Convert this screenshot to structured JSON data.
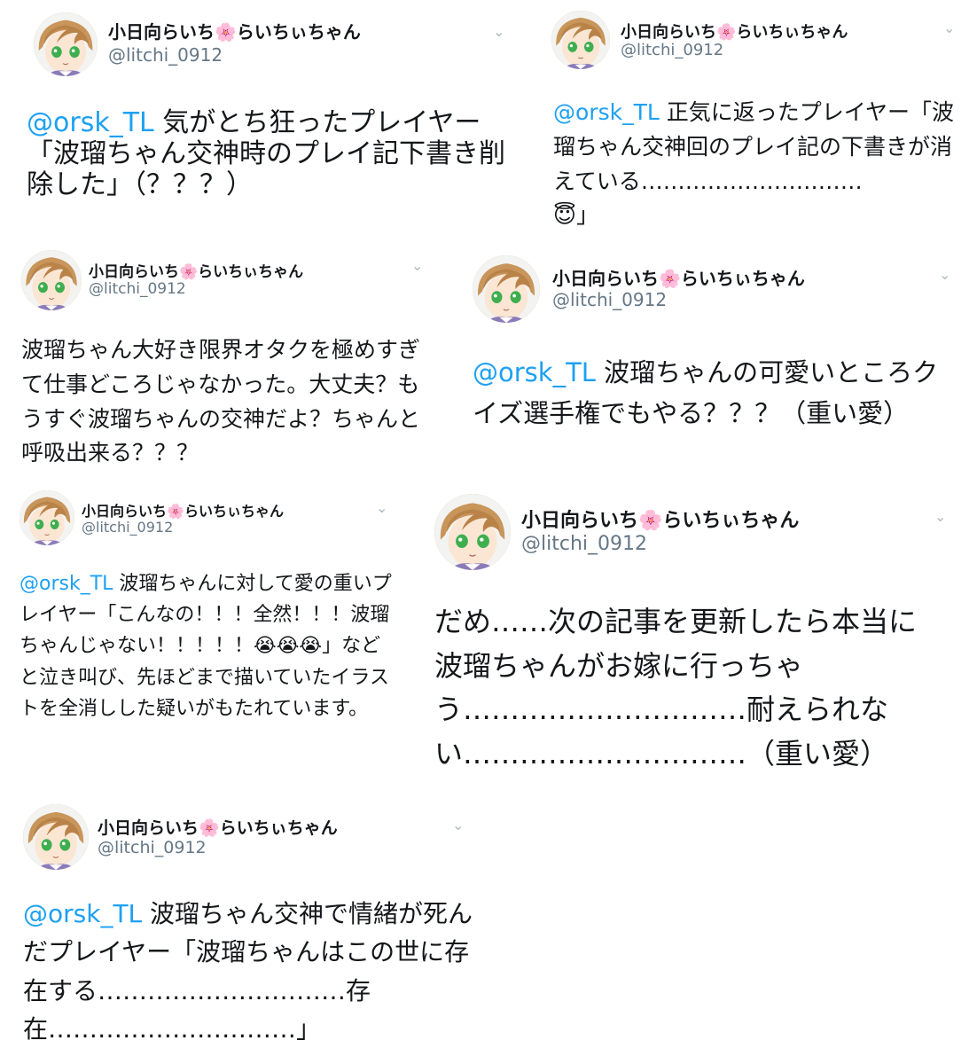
{
  "tweets": [
    {
      "display_name": "小日向らいち",
      "name_emoji": "🌸",
      "display_name_suffix": "らいちぃちゃん",
      "handle": "@litchi_0912",
      "mention": "@orsk_TL",
      "text": " 気がとち狂ったプレイヤー「波瑠ちゃん交神時のプレイ記下書き削除した」（？？？）",
      "menu_icon": "chevron-down-icon"
    },
    {
      "display_name": "小日向らいち",
      "name_emoji": "🌸",
      "display_name_suffix": "らいちぃちゃん",
      "handle": "@litchi_0912",
      "mention": "@orsk_TL",
      "text": " 正気に返ったプレイヤー「波瑠ちゃん交神回のプレイ記の下書きが消えている…………………………",
      "emoji": "😇",
      "text_end": "」",
      "menu_icon": "chevron-down-icon"
    },
    {
      "display_name": "小日向らいち",
      "name_emoji": "🌸",
      "display_name_suffix": "らいちぃちゃん",
      "handle": "@litchi_0912",
      "text": "波瑠ちゃん大好き限界オタクを極めすぎて仕事どころじゃなかった。大丈夫？もうすぐ波瑠ちゃんの交神だよ？ちゃんと呼吸出来る？？？",
      "menu_icon": "chevron-down-icon"
    },
    {
      "display_name": "小日向らいち",
      "name_emoji": "🌸",
      "display_name_suffix": "らいちぃちゃん",
      "handle": "@litchi_0912",
      "mention": "@orsk_TL",
      "text": " 波瑠ちゃんの可愛いところクイズ選手権でもやる？？？（重い愛）",
      "menu_icon": "chevron-down-icon"
    },
    {
      "display_name": "小日向らいち",
      "name_emoji": "🌸",
      "display_name_suffix": "らいちぃちゃん",
      "handle": "@litchi_0912",
      "mention": "@orsk_TL",
      "text": " 波瑠ちゃんに対して愛の重いプレイヤー「こんなの！！！全然！！！波瑠ちゃんじゃない！！！！！",
      "emoji": "😭😭😭",
      "text_end": "」などと泣き叫び、先ほどまで描いていたイラストを全消しした疑いがもたれています。",
      "menu_icon": "chevron-down-icon"
    },
    {
      "display_name": "小日向らいち",
      "name_emoji": "🌸",
      "display_name_suffix": "らいちぃちゃん",
      "handle": "@litchi_0912",
      "text": "だめ……次の記事を更新したら本当に波瑠ちゃんがお嫁に行っちゃう…………………………耐えられない…………………………（重い愛）",
      "menu_icon": "chevron-down-icon"
    },
    {
      "display_name": "小日向らいち",
      "name_emoji": "🌸",
      "display_name_suffix": "らいちぃちゃん",
      "handle": "@litchi_0912",
      "mention": "@orsk_TL",
      "text": " 波瑠ちゃん交神で情緒が死んだプレイヤー「波瑠ちゃんはこの世に存在する…………………………存在…………………………」",
      "menu_icon": "chevron-down-icon"
    }
  ],
  "colors": {
    "mention": "#1da1f2",
    "handle": "#657786",
    "text": "#14171a",
    "chevron": "#aab8c2"
  }
}
